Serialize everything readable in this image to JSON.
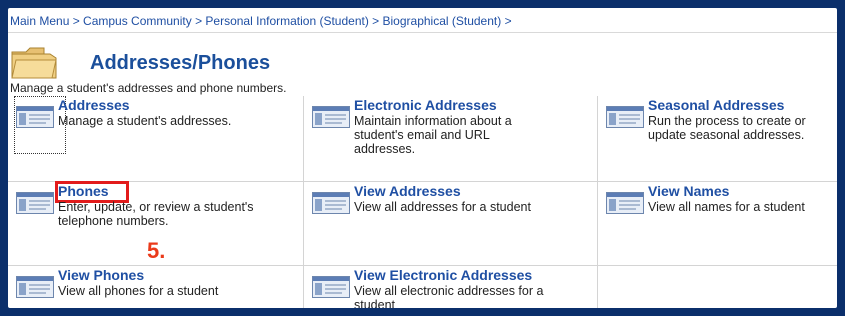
{
  "breadcrumb": {
    "text": "Main Menu > Campus Community > Personal Information (Student) > Biographical (Student) >"
  },
  "page": {
    "title": "Addresses/Phones",
    "description": "Manage a student's addresses and phone numbers.",
    "folder_icon": "folder-icon"
  },
  "tiles": [
    {
      "label": "Addresses",
      "text": "Manage a student's addresses.",
      "icon": "page-icon"
    },
    {
      "label": "Electronic Addresses",
      "text": "Maintain information about a student's email and URL addresses.",
      "icon": "page-icon"
    },
    {
      "label": "Seasonal Addresses",
      "text": "Run the process to create or update seasonal addresses.",
      "icon": "page-icon"
    },
    {
      "label": "Phones",
      "text": "Enter, update, or review a student's telephone numbers.",
      "icon": "page-icon"
    },
    {
      "label": "View Addresses",
      "text": "View all addresses for a student",
      "icon": "page-icon"
    },
    {
      "label": "View Names",
      "text": "View all names for a student",
      "icon": "page-icon"
    },
    {
      "label": "View Phones",
      "text": "View all phones for a student",
      "icon": "page-icon"
    },
    {
      "label": "View Electronic Addresses",
      "text": "View all electronic addresses for a student",
      "icon": "page-icon"
    }
  ],
  "annotation": {
    "step_label": "5.",
    "highlight_color": "#e21b1b"
  },
  "colors": {
    "link": "#1f4fa3",
    "title": "#1b4f9b",
    "background_frame": "#0b2f6b"
  }
}
